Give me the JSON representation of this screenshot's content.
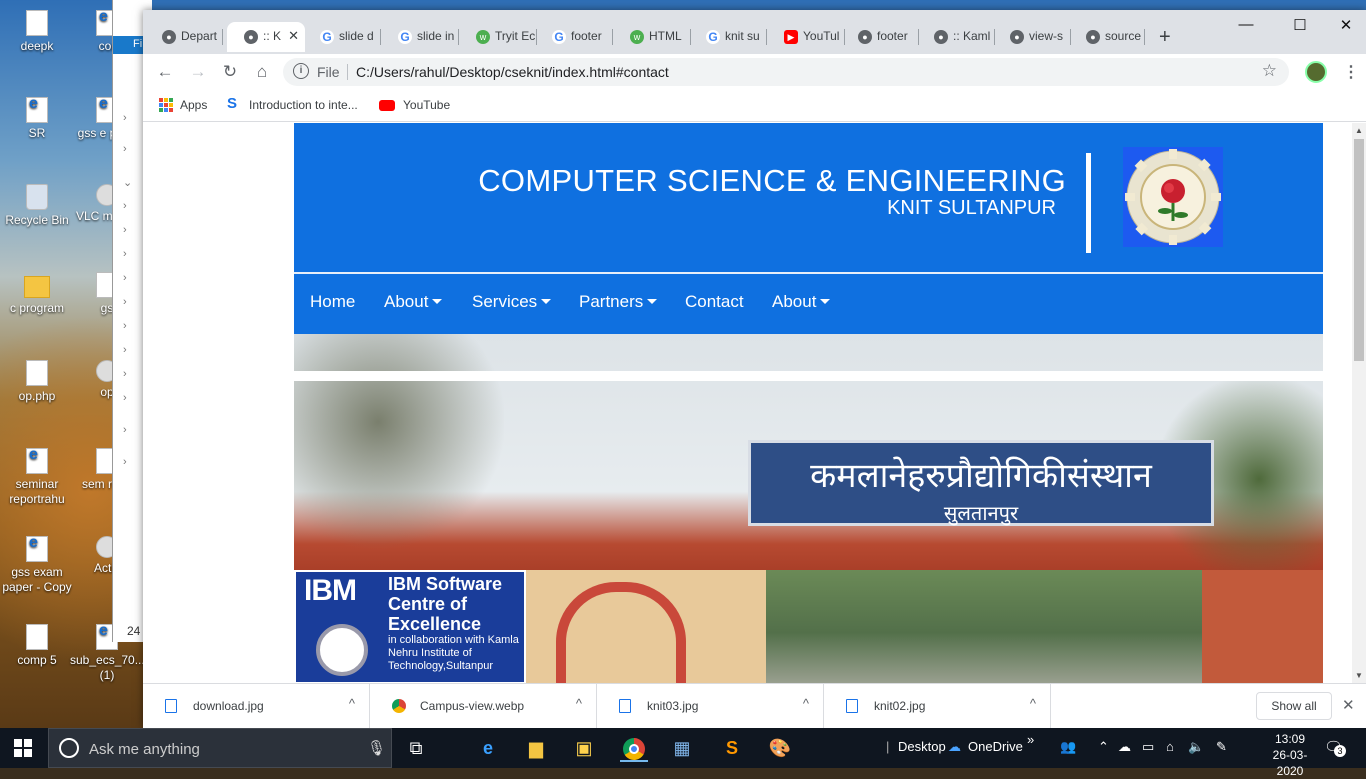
{
  "desktop": {
    "icons": [
      {
        "label": "deepk",
        "type": "docx"
      },
      {
        "label": "SR",
        "type": "pdf"
      },
      {
        "label": "Recycle Bin",
        "type": "bin"
      },
      {
        "label": "c program",
        "type": "folder"
      },
      {
        "label": "op.php",
        "type": "docx"
      },
      {
        "label": "seminar reportrahu",
        "type": "pdf"
      },
      {
        "label": "gss exam paper - Copy",
        "type": "pdf"
      },
      {
        "label": "comp 5",
        "type": "docx"
      },
      {
        "label": "cor",
        "type": "pdf"
      },
      {
        "label": "gss e pape",
        "type": "pdf"
      },
      {
        "label": "VLC m play",
        "type": "gear"
      },
      {
        "label": "gs",
        "type": "docx"
      },
      {
        "label": "op",
        "type": "gear"
      },
      {
        "label": "sem repo",
        "type": "docx"
      },
      {
        "label": "Activ",
        "type": "gear"
      },
      {
        "label": "sub_ecs_70... (1)",
        "type": "pdf"
      }
    ]
  },
  "explorer": {
    "tab_label": "Fi",
    "status": "24"
  },
  "chrome": {
    "tabs": [
      {
        "label": "Depart",
        "fav": "●"
      },
      {
        "label": ":: K",
        "fav": "●",
        "active": true
      },
      {
        "label": "slide d",
        "fav": "G"
      },
      {
        "label": "slide in",
        "fav": "G"
      },
      {
        "label": "Tryit Ec",
        "fav": "w"
      },
      {
        "label": "footer",
        "fav": "G"
      },
      {
        "label": "HTML",
        "fav": "w"
      },
      {
        "label": "knit su",
        "fav": "G"
      },
      {
        "label": "YouTul",
        "fav": "▶"
      },
      {
        "label": "footer",
        "fav": "●"
      },
      {
        "label": ":: Kaml",
        "fav": "●"
      },
      {
        "label": "view-s",
        "fav": "●"
      },
      {
        "label": "source",
        "fav": "●"
      }
    ],
    "tab_close": "✕",
    "new_tab": "+",
    "window_buttons": {
      "minimize": "—",
      "maximize": "☐",
      "close": "✕"
    },
    "nav": {
      "back": "←",
      "forward": "→",
      "reload": "↻",
      "home": "⌂"
    },
    "omnibox": {
      "scheme": "File",
      "url": "C:/Users/rahul/Desktop/cseknit/index.html#contact",
      "info": "i",
      "star": "☆"
    },
    "menu": "⋮",
    "bookmarks": [
      {
        "label": "Apps",
        "icon": "apps-grid"
      },
      {
        "label": "Introduction to inte...",
        "icon": "s-logo"
      },
      {
        "label": "YouTube",
        "icon": "youtube"
      }
    ]
  },
  "site": {
    "title": "COMPUTER SCIENCE & ENGINEERING",
    "subtitle": "KNIT SULTANPUR",
    "nav": [
      {
        "label": "Home",
        "dropdown": false
      },
      {
        "label": "About",
        "dropdown": true
      },
      {
        "label": "Services",
        "dropdown": true
      },
      {
        "label": "Partners",
        "dropdown": true
      },
      {
        "label": "Contact",
        "dropdown": false
      },
      {
        "label": "About",
        "dropdown": true
      }
    ],
    "hero": {
      "sign_main": "कमलानेहरुप्रौद्योगिकीसंस्थान",
      "sign_sub": "सुलतानपुर",
      "ibm_logo": "IBM",
      "ibm_title": "IBM Software Centre of Excellence",
      "ibm_sub": "in collaboration with Kamla Nehru Institute of Technology,Sultanpur"
    }
  },
  "downloads": {
    "items": [
      {
        "name": "download.jpg",
        "icon": "image-file"
      },
      {
        "name": "Campus-view.webp",
        "icon": "chrome"
      },
      {
        "name": "knit03.jpg",
        "icon": "image-file"
      },
      {
        "name": "knit02.jpg",
        "icon": "image-file"
      }
    ],
    "chevron": "^",
    "show_all": "Show all",
    "close": "✕"
  },
  "taskbar": {
    "search_placeholder": "Ask me anything",
    "apps": [
      "task-view",
      "edge",
      "file-explorer",
      "store",
      "chrome",
      "app",
      "sublime",
      "paint"
    ],
    "tray": {
      "desktop": "Desktop",
      "onedrive": "OneDrive",
      "more": "»"
    },
    "time": "13:09",
    "date": "26-03-2020",
    "notifications": "3"
  }
}
